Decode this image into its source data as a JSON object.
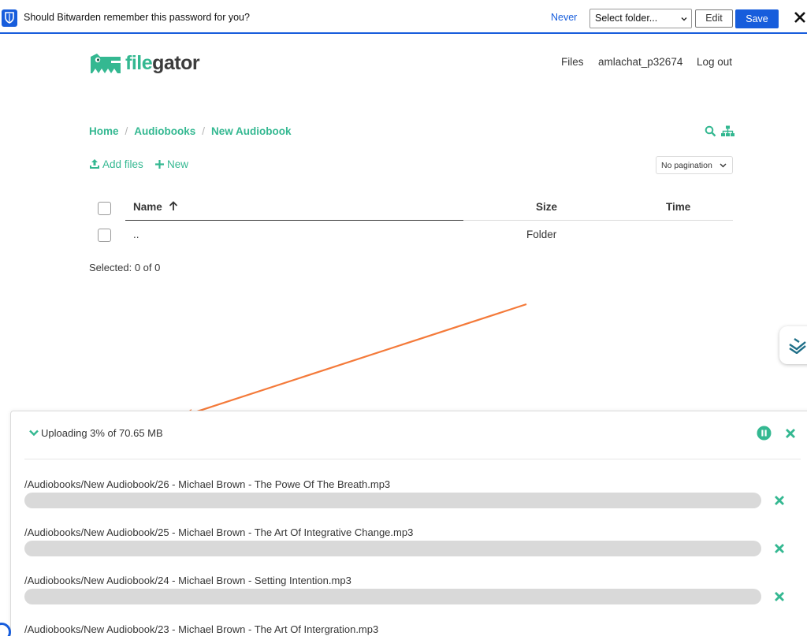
{
  "bitwarden": {
    "message": "Should Bitwarden remember this password for you?",
    "never": "Never",
    "folder_select": "Select folder...",
    "edit": "Edit",
    "save": "Save"
  },
  "app": {
    "logo_part1": "file",
    "logo_part2": "gator",
    "nav": {
      "files": "Files",
      "user": "amlachat_p32674",
      "logout": "Log out"
    }
  },
  "breadcrumb": [
    "Home",
    "Audiobooks",
    "New Audiobook"
  ],
  "actions": {
    "add_files": "Add files",
    "new": "New",
    "pagination": "No pagination"
  },
  "table": {
    "headers": {
      "name": "Name",
      "size": "Size",
      "time": "Time"
    },
    "rows": [
      {
        "name": "..",
        "size": "Folder",
        "time": ""
      }
    ],
    "selected": "Selected: 0 of 0"
  },
  "upload": {
    "status": "Uploading 3% of 70.65 MB",
    "files": [
      {
        "path": "/Audiobooks/New Audiobook/26 - Michael Brown - The Powe Of The Breath.mp3",
        "progress": 0
      },
      {
        "path": "/Audiobooks/New Audiobook/25 - Michael Brown - The Art Of Integrative Change.mp3",
        "progress": 0
      },
      {
        "path": "/Audiobooks/New Audiobook/24 - Michael Brown - Setting Intention.mp3",
        "progress": 0
      },
      {
        "path": "/Audiobooks/New Audiobook/23 - Michael Brown - The Art Of Intergration.mp3",
        "progress": 0
      }
    ]
  },
  "colors": {
    "accent": "#34b891",
    "bitwarden_blue": "#175ddc",
    "annotation_arrow": "#f47a3a"
  }
}
